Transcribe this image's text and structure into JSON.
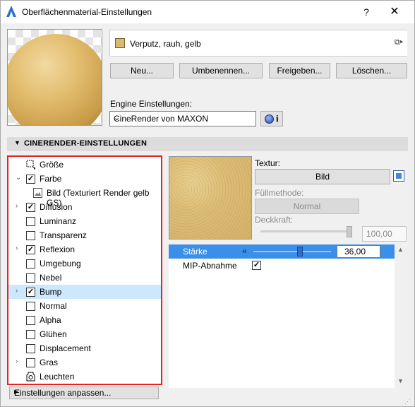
{
  "window": {
    "title": "Oberflächenmaterial-Einstellungen",
    "help": "?",
    "close": "✕"
  },
  "material": {
    "name": "Verputz, rauh, gelb",
    "swatch_color": "#d8b96e",
    "picker": "⧉▸"
  },
  "buttons": {
    "new": "Neu...",
    "rename": "Umbenennen...",
    "share": "Freigeben...",
    "delete": "Löschen..."
  },
  "engine": {
    "label": "Engine Einstellungen:",
    "value": "CineRender von MAXON",
    "info_i": "i"
  },
  "section": {
    "title": "CINERENDER-EINSTELLUNGEN"
  },
  "channels": [
    {
      "label": "Größe",
      "type": "icon",
      "icon": "resize-icon",
      "expander": ""
    },
    {
      "label": "Farbe",
      "type": "checkbox",
      "checked": "✓",
      "expander": "⌄"
    },
    {
      "label": "Bild (Texturiert Render gelb GS)",
      "type": "child",
      "icon": "image-icon"
    },
    {
      "label": "Diffusion",
      "type": "checkbox",
      "checked": "✓",
      "expander": "›"
    },
    {
      "label": "Luminanz",
      "type": "checkbox",
      "checked": ""
    },
    {
      "label": "Transparenz",
      "type": "checkbox",
      "checked": ""
    },
    {
      "label": "Reflexion",
      "type": "checkbox",
      "checked": "✓",
      "expander": "›"
    },
    {
      "label": "Umgebung",
      "type": "checkbox",
      "checked": ""
    },
    {
      "label": "Nebel",
      "type": "checkbox",
      "checked": ""
    },
    {
      "label": "Bump",
      "type": "checkbox",
      "checked": "✓",
      "expander": "›",
      "selected": true
    },
    {
      "label": "Normal",
      "type": "checkbox",
      "checked": ""
    },
    {
      "label": "Alpha",
      "type": "checkbox",
      "checked": ""
    },
    {
      "label": "Glühen",
      "type": "checkbox",
      "checked": ""
    },
    {
      "label": "Displacement",
      "type": "checkbox",
      "checked": ""
    },
    {
      "label": "Gras",
      "type": "checkbox",
      "checked": "",
      "expander": "›"
    },
    {
      "label": "Leuchten",
      "type": "icon",
      "icon": "lamp-icon"
    }
  ],
  "settings_button": "Einstellungen anpassen...",
  "texture": {
    "label": "Textur:",
    "image_button": "Bild",
    "fill_label": "Füllmethode:",
    "fill_value": "Normal",
    "opacity_label": "Deckkraft:",
    "opacity_value": "100,00"
  },
  "params": [
    {
      "label": "Stärke",
      "value": "36,00",
      "level": 0.6
    },
    {
      "label": "MIP-Abnahme",
      "checked": "✓"
    }
  ],
  "colors": {
    "accent": "#3b8fe8",
    "selection": "#cce8ff",
    "highlight_border": "#e52222"
  }
}
